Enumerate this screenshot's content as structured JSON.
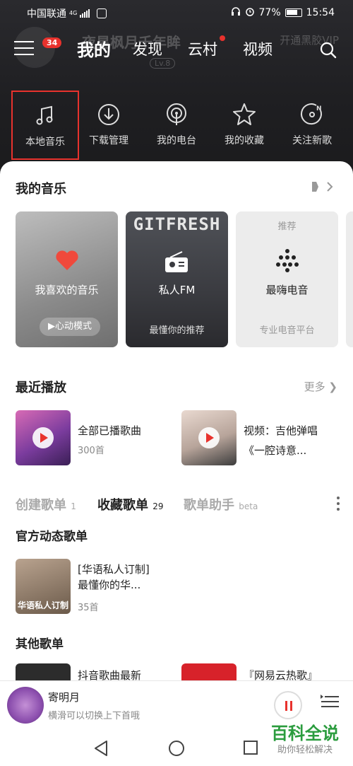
{
  "status_bar": {
    "carrier": "中国联通",
    "network": "4G",
    "battery": "77%",
    "time": "15:54"
  },
  "profile_ghost": {
    "name": "夜星枫月千年眸",
    "vip": "开通黑胶VIP",
    "level": "Lv.8"
  },
  "top_nav": {
    "badge": "34",
    "tabs": [
      "我的",
      "发现",
      "云村",
      "视频"
    ]
  },
  "quick_actions": [
    "本地音乐",
    "下载管理",
    "我的电台",
    "我的收藏",
    "关注新歌"
  ],
  "my_music": {
    "title": "我的音乐",
    "cards": [
      {
        "title": "我喜欢的音乐",
        "sub": "心动模式"
      },
      {
        "title": "私人FM",
        "sub": "最懂你的推荐",
        "banner": "GITFRESH"
      },
      {
        "top": "推荐",
        "title": "最嗨电音",
        "sub": "专业电音平台"
      }
    ]
  },
  "recent": {
    "title": "最近播放",
    "more": "更多",
    "items": [
      {
        "title": "全部已播歌曲",
        "sub": "300首"
      },
      {
        "title": "视频：吉他弹唱",
        "sub": "《一腔诗意..."
      }
    ]
  },
  "playlist_tabs": [
    {
      "label": "创建歌单",
      "count": "1"
    },
    {
      "label": "收藏歌单",
      "count": "29"
    },
    {
      "label": "歌单助手",
      "count": "beta"
    }
  ],
  "official": {
    "title": "官方动态歌单",
    "item": {
      "title_line1": "[华语私人订制]",
      "title_line2": "最懂你的华...",
      "sub": "35首",
      "cover_tag": "华语私人订制"
    }
  },
  "other": {
    "title": "其他歌单",
    "items": [
      "抖音歌曲最新",
      "『网易云热歌』"
    ]
  },
  "player": {
    "title": "寄明月",
    "sub": "横滑可以切换上下首哦"
  },
  "watermark": {
    "main": "百科全说",
    "sub": "助你轻松解决"
  }
}
